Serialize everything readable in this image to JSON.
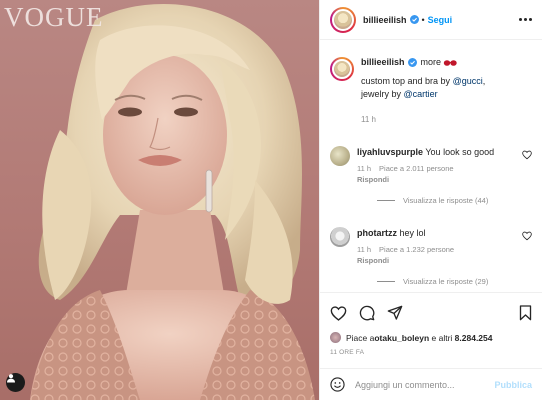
{
  "photo": {
    "magazine_logo": "VOGUE"
  },
  "header": {
    "username": "billieeilish",
    "follow_label": "Segui"
  },
  "caption": {
    "username": "billieeilish",
    "more_label": "more",
    "text_prefix": "custom top and bra by ",
    "mention_1": "@gucci",
    "text_middle": ",\njewelry by ",
    "mention_2": "@cartier",
    "time": "11 h"
  },
  "comments": [
    {
      "username": "liyahluvspurple",
      "text": "You look so good",
      "time": "11 h",
      "likes": "Piace a 2.011 persone",
      "reply_label": "Rispondi",
      "view_replies": "Visualizza le risposte (44)"
    },
    {
      "username": "photartzz",
      "text": "hey lol",
      "time": "11 h",
      "likes": "Piace a 1.232 persone",
      "reply_label": "Rispondi",
      "view_replies": "Visualizza le risposte (29)"
    }
  ],
  "likes": {
    "prefix": "Piace a ",
    "user": "otaku_boleyn",
    "middle": " e altri ",
    "count": "8.284.254"
  },
  "posted_ago": "11 ORE FA",
  "add_comment": {
    "placeholder": "Aggiungi un commento...",
    "publish_label": "Pubblica"
  },
  "colors": {
    "accent_blue": "#0095f6",
    "publish_disabled": "#b2dffc",
    "verified": "#3897f0",
    "muted": "#8e8e8e"
  }
}
